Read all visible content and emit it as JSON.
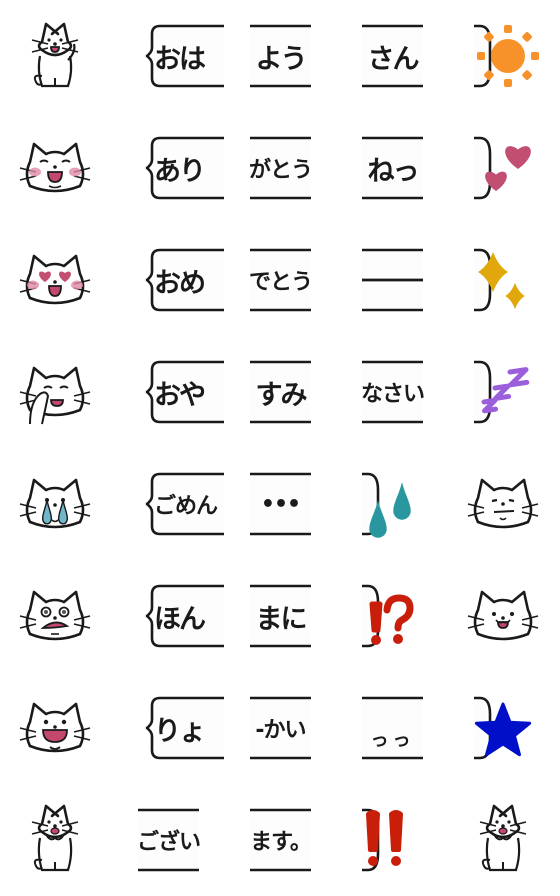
{
  "title": "Cat speech bubble emoji set",
  "colors": {
    "stroke": "#1a1a1a",
    "bubble_fill": "#fdfdfd",
    "cheek": "#e08aa8",
    "mouth": "#c4476e",
    "sun": "#f7922a",
    "heart": "#c24f72",
    "sparkle": "#e0a80a",
    "zzz": "#9b5fdc",
    "drop": "#2a97a0",
    "exclaim": "#c81e0a",
    "star": "#0010c8",
    "tear": "#6fb7c9"
  },
  "rows": [
    {
      "cells": [
        {
          "kind": "cat",
          "icon": "cat-waving-icon"
        },
        {
          "kind": "bubble-start",
          "text": "おは"
        },
        {
          "kind": "bubble-mid",
          "text": "よう"
        },
        {
          "kind": "bubble-mid",
          "text": "さん"
        },
        {
          "kind": "bubble-end",
          "icon": "sun-icon"
        }
      ]
    },
    {
      "cells": [
        {
          "kind": "cat",
          "icon": "cat-blushing-smile-icon"
        },
        {
          "kind": "bubble-start",
          "text": "あり"
        },
        {
          "kind": "bubble-mid",
          "text": "がとう"
        },
        {
          "kind": "bubble-mid",
          "text": "ねっ"
        },
        {
          "kind": "bubble-end",
          "icon": "hearts-icon"
        }
      ]
    },
    {
      "cells": [
        {
          "kind": "cat",
          "icon": "cat-heart-eyes-icon"
        },
        {
          "kind": "bubble-start",
          "text": "おめ"
        },
        {
          "kind": "bubble-mid",
          "text": "でとう"
        },
        {
          "kind": "bubble-mid",
          "text": "—"
        },
        {
          "kind": "bubble-end",
          "icon": "sparkles-icon"
        }
      ]
    },
    {
      "cells": [
        {
          "kind": "cat",
          "icon": "cat-sleepy-icon"
        },
        {
          "kind": "bubble-start",
          "text": "おや"
        },
        {
          "kind": "bubble-mid",
          "text": "すみ"
        },
        {
          "kind": "bubble-mid",
          "text": "なさい"
        },
        {
          "kind": "bubble-end",
          "icon": "zzz-icon"
        }
      ]
    },
    {
      "cells": [
        {
          "kind": "cat",
          "icon": "cat-crying-icon"
        },
        {
          "kind": "bubble-start",
          "text": "ごめん"
        },
        {
          "kind": "bubble-mid",
          "text": "•••"
        },
        {
          "kind": "bubble-end",
          "icon": "sweat-drops-icon"
        },
        {
          "kind": "cat",
          "icon": "cat-content-icon"
        }
      ]
    },
    {
      "cells": [
        {
          "kind": "cat",
          "icon": "cat-shocked-icon"
        },
        {
          "kind": "bubble-start",
          "text": "ほん"
        },
        {
          "kind": "bubble-mid",
          "text": "まに"
        },
        {
          "kind": "bubble-end",
          "icon": "exclamation-question-icon"
        },
        {
          "kind": "cat",
          "icon": "cat-happy-icon"
        }
      ]
    },
    {
      "cells": [
        {
          "kind": "cat",
          "icon": "cat-laughing-icon"
        },
        {
          "kind": "bubble-start",
          "text": "りょ"
        },
        {
          "kind": "bubble-mid",
          "text": "-かい"
        },
        {
          "kind": "bubble-mid",
          "text": "っっ"
        },
        {
          "kind": "bubble-end",
          "icon": "star-icon"
        }
      ]
    },
    {
      "cells": [
        {
          "kind": "cat",
          "icon": "cat-cheering-icon"
        },
        {
          "kind": "bubble-mid",
          "text": "ござい"
        },
        {
          "kind": "bubble-mid",
          "text": "ます。"
        },
        {
          "kind": "bubble-end",
          "icon": "double-exclamation-icon"
        },
        {
          "kind": "cat",
          "icon": "cat-excited-icon"
        }
      ]
    }
  ]
}
